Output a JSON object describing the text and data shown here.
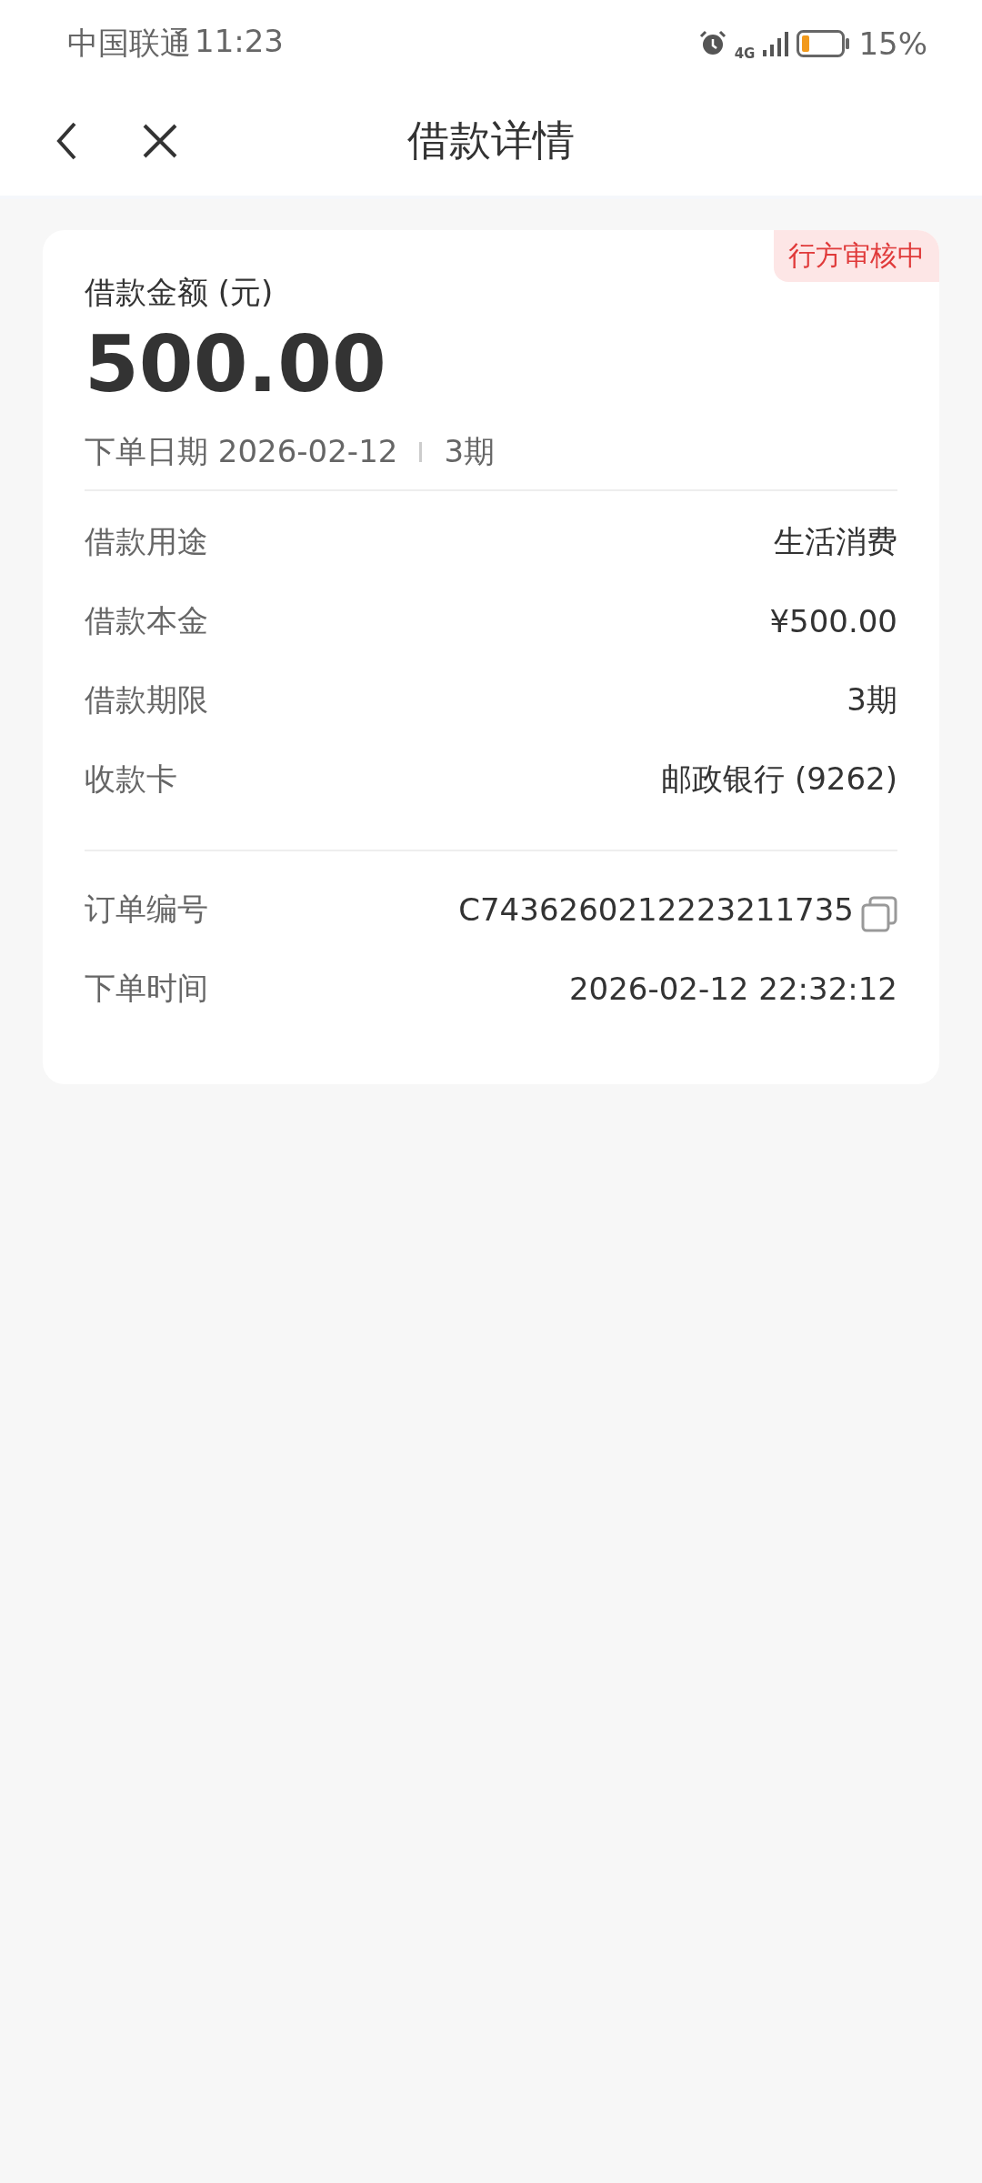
{
  "status_bar": {
    "carrier": "中国联通",
    "time": "11:23",
    "network": "4G",
    "battery": "15%"
  },
  "header": {
    "title": "借款详情"
  },
  "loan": {
    "status": "行方审核中",
    "amount_label": "借款金额 (元)",
    "amount": "500.00",
    "order_date": "下单日期 2026-02-12",
    "term": "3期",
    "details": [
      {
        "label": "借款用途",
        "value": "生活消费"
      },
      {
        "label": "借款本金",
        "value": "¥500.00"
      },
      {
        "label": "借款期限",
        "value": "3期"
      },
      {
        "label": "收款卡",
        "value": "邮政银行 (9262)"
      }
    ],
    "order": [
      {
        "kind": "copy",
        "label": "订单编号",
        "value": "C7436260212223211735"
      },
      {
        "kind": "plain",
        "label": "下单时间",
        "value": "2026-02-12 22:32:12"
      }
    ]
  }
}
